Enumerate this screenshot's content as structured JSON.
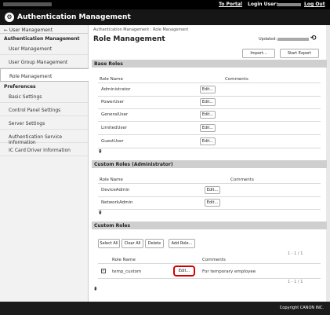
{
  "topbar": {
    "portal_link": "To Portal",
    "login_label": "Login User:",
    "logout_link": "Log Out"
  },
  "app": {
    "title": "Authentication Management"
  },
  "sidebar": {
    "back_link": "← User Management",
    "group1_heading": "Authentication Management",
    "group1_items": [
      {
        "label": "User Management"
      },
      {
        "label": "User Group Management"
      },
      {
        "label": "Role Management",
        "active": true
      }
    ],
    "group2_heading": "Preferences",
    "group2_items": [
      {
        "label": "Basic Settings"
      },
      {
        "label": "Control Panel Settings"
      },
      {
        "label": "Server Settings"
      },
      {
        "label": "Authentication Service Information"
      },
      {
        "label": "IC Card Driver Information"
      }
    ]
  },
  "main": {
    "breadcrumb": "Authentication Management : Role Management",
    "title": "Role Management",
    "updated_label": "Updated:",
    "import_label": "Import...",
    "start_export_label": "Start Export",
    "base_roles": {
      "heading": "Base Roles",
      "col_role_name": "Role Name",
      "col_comments": "Comments",
      "rows": [
        {
          "name": "Administrator",
          "edit": "Edit..."
        },
        {
          "name": "PowerUser",
          "edit": "Edit..."
        },
        {
          "name": "GeneralUser",
          "edit": "Edit..."
        },
        {
          "name": "LimitedUser",
          "edit": "Edit..."
        },
        {
          "name": "GuestUser",
          "edit": "Edit..."
        }
      ]
    },
    "custom_admin_roles": {
      "heading": "Custom Roles (Administrator)",
      "col_role_name": "Role Name",
      "col_comments": "Comments",
      "rows": [
        {
          "name": "DeviceAdmin",
          "edit": "Edit..."
        },
        {
          "name": "NetworkAdmin",
          "edit": "Edit..."
        }
      ]
    },
    "custom_roles": {
      "heading": "Custom Roles",
      "select_all": "Select All",
      "clear_all": "Clear All",
      "delete": "Delete",
      "add_role": "Add Role...",
      "pager_top": "1 - 1 / 1",
      "pager_bottom": "1 - 1 / 1",
      "col_role_name": "Role Name",
      "col_comments": "Comments",
      "rows": [
        {
          "name": "temp_custom",
          "edit": "Edit...",
          "comment": "For temporary employee",
          "checked": true
        }
      ]
    }
  },
  "footer": {
    "copyright": "Copyright CANON INC."
  },
  "colors": {
    "highlight": "#d40000",
    "section_bar": "#cfcfcf",
    "topbar": "#000000"
  }
}
